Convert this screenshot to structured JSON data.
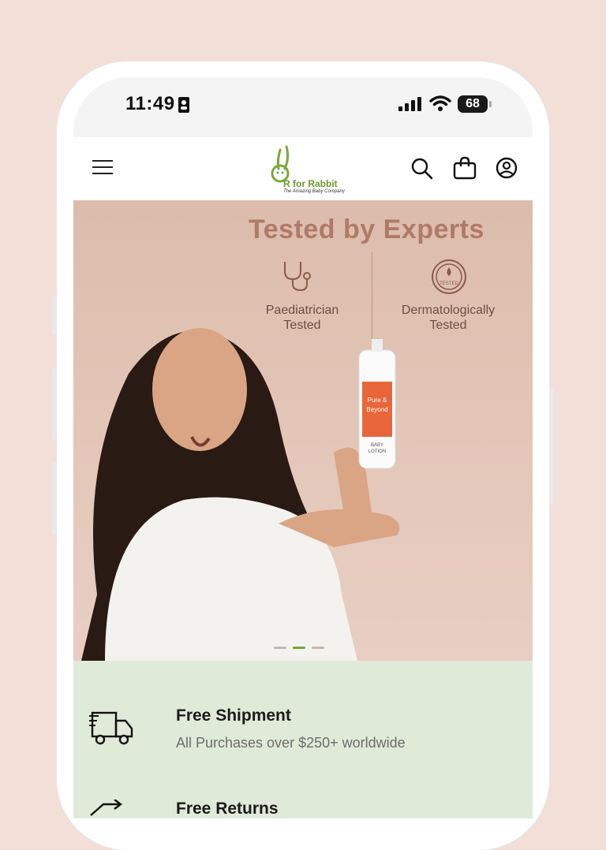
{
  "status_bar": {
    "time": "11:49",
    "battery": "68"
  },
  "header": {
    "logo": {
      "name": "R for Rabbit",
      "tagline": "The Amazing Baby Company"
    },
    "icons": [
      "menu-icon",
      "search-icon",
      "bag-icon",
      "account-icon"
    ]
  },
  "hero": {
    "title": "Tested by Experts",
    "features": [
      {
        "label_line1": "Paediatrician",
        "label_line2": "Tested",
        "icon": "stethoscope-icon"
      },
      {
        "label_line1": "Dermatologically",
        "label_line2": "Tested",
        "icon": "tested-badge-icon",
        "badge_text": "TESTED"
      }
    ],
    "product": {
      "line1": "Pure &",
      "line2": "Beyond",
      "line3": "BABY",
      "line4": "LOTION"
    },
    "slides": {
      "count": 3,
      "active": 2
    }
  },
  "benefits": [
    {
      "title": "Free Shipment",
      "subtitle": "All Purchases over $250+ worldwide",
      "icon": "truck-icon"
    },
    {
      "title": "Free Returns",
      "icon": "return-icon"
    }
  ],
  "colors": {
    "page_bg": "#f2dfd8",
    "brand_green": "#6a9a2a",
    "hero_title": "#b07a66",
    "benefits_bg": "#e0ead8"
  }
}
